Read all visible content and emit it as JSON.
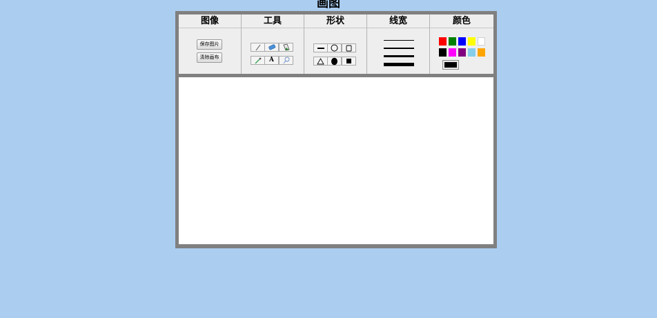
{
  "app": {
    "title": "画图"
  },
  "sections": {
    "image": {
      "title": "图像",
      "save_label": "保存图片",
      "clear_label": "清除画布"
    },
    "tools": {
      "title": "工具",
      "items": [
        "pencil",
        "eraser",
        "fill",
        "eyedropper",
        "text",
        "magnifier"
      ],
      "text_tool_glyph": "A"
    },
    "shapes": {
      "title": "形状",
      "items": [
        "line",
        "circle",
        "rectangle",
        "triangle",
        "filled-circle",
        "filled-rectangle"
      ]
    },
    "line_width": {
      "title": "线宽",
      "widths": [
        1,
        2,
        3,
        5
      ]
    },
    "colors": {
      "title": "颜色",
      "palette": [
        "#ff0000",
        "#008000",
        "#0000ff",
        "#ffff00",
        "#ffffff",
        "#000000",
        "#ff00ff",
        "#800080",
        "#87ceeb",
        "#ffa500"
      ],
      "current": "#000000"
    }
  }
}
